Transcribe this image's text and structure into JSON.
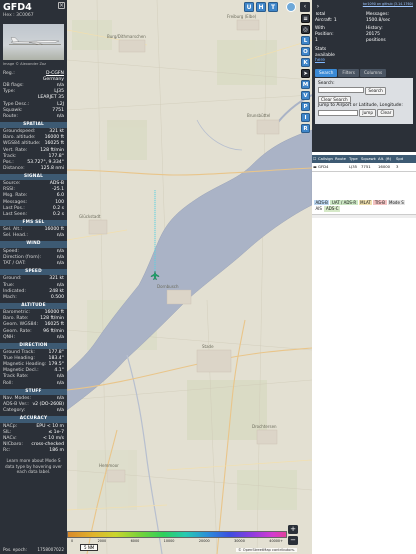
{
  "aircraft": {
    "callsign": "GFD4",
    "hex_label": "Hex : 3C0067",
    "photo_credit": "Image © Alexander Zoz",
    "reg": "D-CGFN",
    "country": "Germany",
    "db_flags": "n/a",
    "type": "LJ35",
    "type_full": "LEARJET 35",
    "type_desc": "L2J",
    "squawk": "7751",
    "route": "n/a"
  },
  "sections": {
    "spatial": "SPATIAL",
    "signal": "SIGNAL",
    "fms": "FMS SEL",
    "wind": "WIND",
    "speed": "SPEED",
    "altitude": "ALTITUDE",
    "direction": "DIRECTION",
    "stuff": "STUFF",
    "accuracy": "ACCURACY"
  },
  "spatial": [
    {
      "k": "Groundspeed:",
      "v": "321 kt"
    },
    {
      "k": "Baro. altitude:",
      "v": "16000 ft"
    },
    {
      "k": "WGS84 altitude:",
      "v": "16025 ft"
    },
    {
      "k": "Vert. Rate:",
      "v": "128 ft/min"
    },
    {
      "k": "Track:",
      "v": "177.8°"
    },
    {
      "k": "Pos.:",
      "v": "53.727°, 9.334°"
    },
    {
      "k": "Distance:",
      "v": "125.8 nmi"
    }
  ],
  "signal": [
    {
      "k": "Source:",
      "v": "ADS-B"
    },
    {
      "k": "RSSI:",
      "v": "-25.1"
    },
    {
      "k": "Msg. Rate:",
      "v": "6.0"
    },
    {
      "k": "Messages:",
      "v": "100"
    },
    {
      "k": "Last Pos.:",
      "v": "0.2 s"
    },
    {
      "k": "Last Seen:",
      "v": "0.2 s"
    }
  ],
  "fms": [
    {
      "k": "Sel. Alt.:",
      "v": "16000 ft"
    },
    {
      "k": "Sel. Head.:",
      "v": "n/a"
    }
  ],
  "wind": [
    {
      "k": "Speed:",
      "v": "n/a"
    },
    {
      "k": "Direction (from):",
      "v": "n/a"
    },
    {
      "k": "TAT / OAT:",
      "v": "n/a"
    }
  ],
  "speed": [
    {
      "k": "Ground:",
      "v": "321 kt"
    },
    {
      "k": "True:",
      "v": "n/a"
    },
    {
      "k": "Indicated:",
      "v": "248 kt"
    },
    {
      "k": "Mach:",
      "v": "0.500"
    }
  ],
  "altitude": [
    {
      "k": "Barometric:",
      "v": "16000 ft"
    },
    {
      "k": "Baro. Rate:",
      "v": "128 ft/min"
    },
    {
      "k": "Geom. WGS84:",
      "v": "16025 ft"
    },
    {
      "k": "Geom. Rate:",
      "v": "96 ft/min"
    },
    {
      "k": "QNH:",
      "v": "n/a"
    }
  ],
  "direction": [
    {
      "k": "Ground Track:",
      "v": "177.8°"
    },
    {
      "k": "True Heading:",
      "v": "183.4°"
    },
    {
      "k": "Magnetic Heading:",
      "v": "179.5°"
    },
    {
      "k": "Magnetic Decl.:",
      "v": "4.1°"
    },
    {
      "k": "Track Rate:",
      "v": "n/a"
    },
    {
      "k": "Roll:",
      "v": "n/a"
    }
  ],
  "stuff": [
    {
      "k": "Nav. Modes:",
      "v": "n/a"
    },
    {
      "k": "ADS-B Ver.:",
      "v": "v2 (DO-260B)"
    },
    {
      "k": "Category:",
      "v": "n/a"
    }
  ],
  "accuracy": [
    {
      "k": "NACp:",
      "v": "EPU < 10 m"
    },
    {
      "k": "SIL:",
      "v": "≤ 1e-7"
    },
    {
      "k": "NACv:",
      "v": "< 10 m/s"
    },
    {
      "k": "NICbaro:",
      "v": "cross-checked"
    },
    {
      "k": "Rc:",
      "v": "186 m"
    }
  ],
  "info_footer": "Learn more about Mode S data type by hovering over each data label.",
  "pos_epoch_label": "Pos. epoch:",
  "pos_epoch_value": "1758007022",
  "sidebar": {
    "version": "tar1090 on github (3.14.1760)",
    "total_aircraft": "Total Aircraft: 1",
    "with_position": "With Position: 1",
    "messages": "Messages: 1500.8/sec",
    "history": "History: 20175 positions",
    "stats_available": "Stats available",
    "stats_link": "here",
    "tabs": [
      "Search",
      "Filters",
      "Columns"
    ],
    "search_label": "Search:",
    "search_button": "Search",
    "clear_search": "Clear Search",
    "jump_label": "Jump to Airport or Latitude, Longitude:",
    "jump_button": "Jump",
    "clear_button": "Clear",
    "table_headers": [
      "Callsign",
      "Route",
      "Type",
      "Squawk",
      "Alt. (ft)",
      "Spd"
    ],
    "table_row": [
      "GFD4",
      "",
      "LJ35",
      "7751",
      "16000",
      "3"
    ],
    "legend": [
      "ADS-B",
      "UAT / ADS-R",
      "MLAT",
      "TIS-B",
      "Mode S",
      "AIS",
      "ADS-C"
    ]
  },
  "map_buttons": {
    "top": [
      "U",
      "H",
      "T"
    ],
    "column": [
      "L",
      "O",
      "K",
      "M",
      "V",
      "P",
      "I",
      "R"
    ]
  },
  "map": {
    "scale_label": "5 NM",
    "attribution": "© OpenStreetMap contributors.",
    "altitude_ticks": [
      "0",
      "",
      "2000",
      "",
      "",
      "6000",
      "",
      "",
      "10000",
      "",
      "",
      "20000",
      "",
      "30000",
      "",
      "40000+"
    ],
    "place_labels": [
      "Burg/Dithmarschen",
      "Brunsbüttel",
      "Glückstadt",
      "Stade",
      "Dornbusch",
      "Drochtersen",
      "Hemmoor",
      "Freiburg (Elbe)"
    ]
  },
  "colors": {
    "accent": "#3f86c9",
    "header_bar": "#3d5a73",
    "track": "#5bd1e0",
    "river": "#aab3c6"
  }
}
